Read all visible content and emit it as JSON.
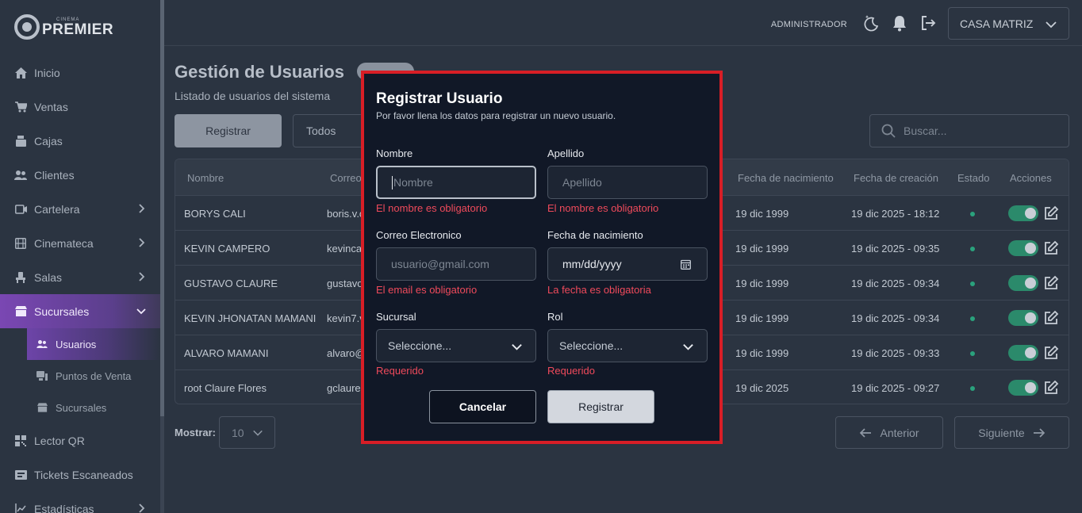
{
  "brand": {
    "small": "CINEMA",
    "name": "PREMIER"
  },
  "nav": {
    "items": [
      {
        "label": "Inicio",
        "icon": "home-icon"
      },
      {
        "label": "Ventas",
        "icon": "cart-icon"
      },
      {
        "label": "Cajas",
        "icon": "register-icon"
      },
      {
        "label": "Clientes",
        "icon": "users-icon"
      },
      {
        "label": "Cartelera",
        "icon": "film-icon"
      },
      {
        "label": "Cinemateca",
        "icon": "film-strip-icon"
      },
      {
        "label": "Salas",
        "icon": "seat-icon"
      },
      {
        "label": "Sucursales",
        "icon": "store-icon"
      }
    ],
    "sub_items": [
      {
        "label": "Usuarios",
        "icon": "users-icon"
      },
      {
        "label": "Puntos de Venta",
        "icon": "pos-icon"
      },
      {
        "label": "Sucursales",
        "icon": "store-icon"
      }
    ],
    "bottom_items": [
      {
        "label": "Lector QR",
        "icon": "qr-icon"
      },
      {
        "label": "Tickets Escaneados",
        "icon": "ticket-icon"
      },
      {
        "label": "Estadísticas",
        "icon": "chart-icon"
      }
    ]
  },
  "header": {
    "user": "ADMINISTRADOR",
    "branch": "CASA MATRIZ"
  },
  "main": {
    "title": "Gestión de Usuarios",
    "subtitle": "Listado de usuarios del sistema",
    "register_label": "Registrar",
    "filter_value": "Todos",
    "search_placeholder": "Buscar...",
    "columns": [
      "Nombre",
      "Correo",
      "Fecha de nacimiento",
      "Fecha de creación",
      "Estado",
      "Acciones"
    ],
    "rows": [
      {
        "name": "BORYS CALI",
        "email": "boris.v.c",
        "birth": "19 dic 1999",
        "created": "19 dic 2025 - 18:12"
      },
      {
        "name": "KEVIN CAMPERO",
        "email": "kevinca",
        "birth": "19 dic 1999",
        "created": "19 dic 2025 - 09:35"
      },
      {
        "name": "GUSTAVO CLAURE",
        "email": "gustavo",
        "birth": "19 dic 1999",
        "created": "19 dic 2025 - 09:34"
      },
      {
        "name": "KEVIN JHONATAN MAMANI",
        "email": "kevin7.v",
        "birth": "19 dic 1999",
        "created": "19 dic 2025 - 09:34"
      },
      {
        "name": "ALVARO MAMANI",
        "email": "alvaro@",
        "birth": "19 dic 1999",
        "created": "19 dic 2025 - 09:33"
      },
      {
        "name": "root Claure Flores",
        "email": "gclaure",
        "birth": "19 dic 2025",
        "created": "19 dic 2025 - 09:27"
      }
    ],
    "show_label": "Mostrar:",
    "show_value": "10",
    "prev_label": "Anterior",
    "next_label": "Siguiente"
  },
  "modal": {
    "title": "Registrar Usuario",
    "subtitle": "Por favor llena los datos para registrar un nuevo usuario.",
    "nombre": {
      "label": "Nombre",
      "placeholder": "Nombre",
      "error": "El nombre es obligatorio"
    },
    "apellido": {
      "label": "Apellido",
      "placeholder": "Apellido",
      "error": "El nombre es obligatorio"
    },
    "email": {
      "label": "Correo Electronico",
      "placeholder": "usuario@gmail.com",
      "error": "El email es obligatorio"
    },
    "birth": {
      "label": "Fecha de nacimiento",
      "value": "mm/dd/yyyy",
      "error": "La fecha es obligatoria"
    },
    "sucursal": {
      "label": "Sucursal",
      "value": "Seleccione...",
      "error": "Requerido"
    },
    "rol": {
      "label": "Rol",
      "value": "Seleccione...",
      "error": "Requerido"
    },
    "cancel_label": "Cancelar",
    "submit_label": "Registrar"
  },
  "colors": {
    "accent": "#7a47b3",
    "error": "#ef4a5b",
    "highlight": "#d81e26",
    "active_toggle": "#2b8a6b"
  }
}
